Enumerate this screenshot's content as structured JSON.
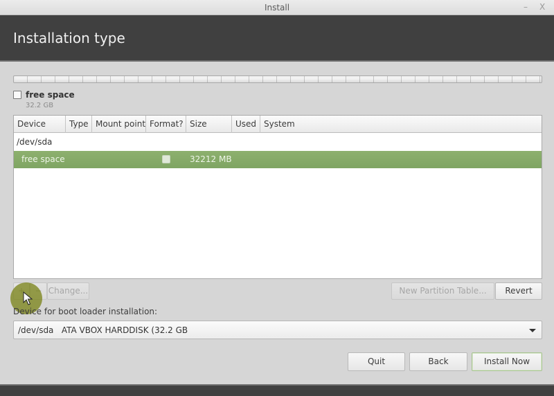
{
  "window": {
    "title": "Install",
    "minimize_glyph": "–",
    "close_glyph": "X"
  },
  "header": {
    "title": "Installation type"
  },
  "partition_bar": {
    "segments": [
      {
        "label": "free space",
        "size": "32.2 GB",
        "fraction": 1.0
      }
    ]
  },
  "legend": {
    "name": "free space",
    "size": "32.2 GB"
  },
  "table": {
    "columns": [
      "Device",
      "Type",
      "Mount point",
      "Format?",
      "Size",
      "Used",
      "System"
    ],
    "rows": [
      {
        "device": "/dev/sda",
        "type": "",
        "mount_point": "",
        "format": null,
        "size": "",
        "used": "",
        "system": "",
        "selected": false
      },
      {
        "device": "free space",
        "type": "",
        "mount_point": "",
        "format": false,
        "size": "32212 MB",
        "used": "",
        "system": "",
        "selected": true
      }
    ]
  },
  "actions": {
    "add": "+",
    "remove": "−",
    "change": "Change...",
    "new_partition_table": "New Partition Table...",
    "revert": "Revert"
  },
  "bootloader": {
    "label": "Device for boot loader installation:",
    "selected": "/dev/sda   ATA VBOX HARDDISK (32.2 GB"
  },
  "footer": {
    "quit": "Quit",
    "back": "Back",
    "install_now": "Install Now"
  },
  "colors": {
    "header_bg": "#404040",
    "selection_green": "#86ab69",
    "window_bg": "#d6d6d6"
  }
}
